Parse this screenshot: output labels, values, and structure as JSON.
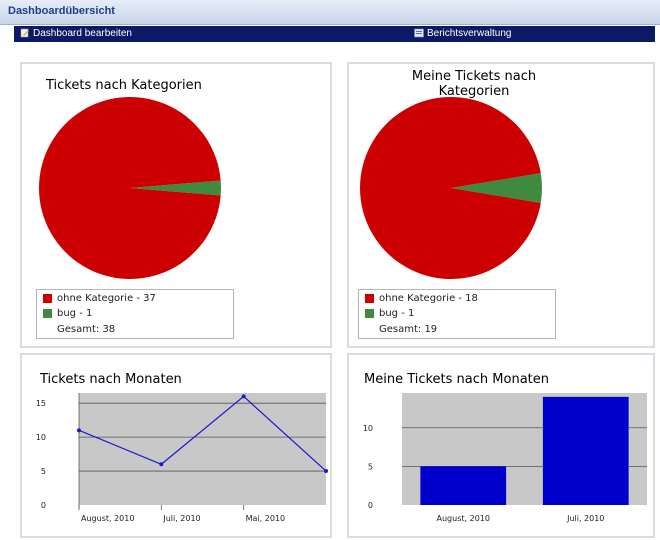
{
  "window": {
    "title": "Dashboardübersicht"
  },
  "toolbar": {
    "edit_label": "Dashboard bearbeiten",
    "reports_label": "Berichtsverwaltung"
  },
  "colors": {
    "red": "#cc0000",
    "green": "#3f8a3f",
    "blue": "#0000cc",
    "plot_bg": "#c8c8c8"
  },
  "panels": {
    "tickets_by_category": {
      "title": "Tickets nach Kategorien",
      "legend": [
        {
          "label": "ohne Kategorie - 37",
          "color": "#cc0000"
        },
        {
          "label": "bug - 1",
          "color": "#3f8a3f"
        }
      ],
      "total": "Gesamt: 38"
    },
    "my_tickets_by_category": {
      "title": "Meine Tickets nach Kategorien",
      "legend": [
        {
          "label": "ohne Kategorie - 18",
          "color": "#cc0000"
        },
        {
          "label": "bug - 1",
          "color": "#3f8a3f"
        }
      ],
      "total": "Gesamt: 19"
    },
    "tickets_by_month": {
      "title": "Tickets nach Monaten"
    },
    "my_tickets_by_month": {
      "title": "Meine Tickets nach Monaten"
    }
  },
  "chart_data": [
    {
      "type": "pie",
      "title": "Tickets nach Kategorien",
      "categories": [
        "ohne Kategorie",
        "bug"
      ],
      "values": [
        37,
        1
      ],
      "colors": [
        "#cc0000",
        "#3f8a3f"
      ]
    },
    {
      "type": "pie",
      "title": "Meine Tickets nach Kategorien",
      "categories": [
        "ohne Kategorie",
        "bug"
      ],
      "values": [
        18,
        1
      ],
      "colors": [
        "#cc0000",
        "#3f8a3f"
      ]
    },
    {
      "type": "line",
      "title": "Tickets nach Monaten",
      "categories": [
        "August, 2010",
        "Juli, 2010",
        "Mai, 2010"
      ],
      "values": [
        11,
        6,
        16,
        5
      ],
      "yticks": [
        0,
        5,
        10,
        15
      ],
      "ylim": [
        0,
        16.5
      ],
      "grid": true
    },
    {
      "type": "bar",
      "title": "Meine Tickets nach Monaten",
      "categories": [
        "August, 2010",
        "Juli, 2010"
      ],
      "values": [
        5,
        14
      ],
      "yticks": [
        0,
        5,
        10
      ],
      "ylim": [
        0,
        14.5
      ],
      "grid": true
    }
  ]
}
